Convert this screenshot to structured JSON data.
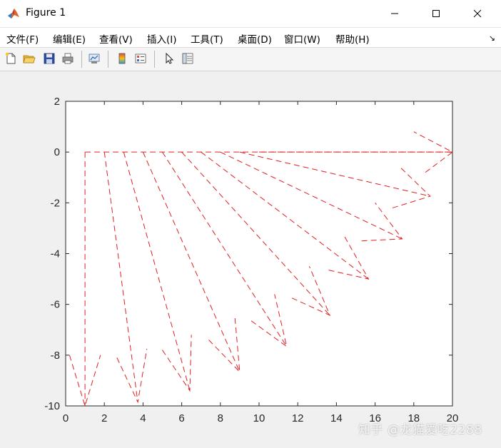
{
  "window": {
    "title": "Figure 1",
    "icon": "matlab-icon"
  },
  "menu": {
    "items": [
      {
        "label": "文件(F)",
        "name": "menu-file"
      },
      {
        "label": "编辑(E)",
        "name": "menu-edit"
      },
      {
        "label": "查看(V)",
        "name": "menu-view"
      },
      {
        "label": "插入(I)",
        "name": "menu-insert"
      },
      {
        "label": "工具(T)",
        "name": "menu-tools"
      },
      {
        "label": "桌面(D)",
        "name": "menu-desktop"
      },
      {
        "label": "窗口(W)",
        "name": "menu-window"
      },
      {
        "label": "帮助(H)",
        "name": "menu-help"
      }
    ],
    "overflow_icon": "menu-overflow-arrow-icon"
  },
  "toolbar": {
    "buttons": [
      {
        "name": "new-figure-button",
        "icon": "new-file-icon"
      },
      {
        "name": "open-file-button",
        "icon": "folder-open-icon"
      },
      {
        "name": "save-button",
        "icon": "save-disk-icon"
      },
      {
        "name": "print-button",
        "icon": "printer-icon"
      },
      {
        "name": "link-plot-button",
        "icon": "link-plot-icon"
      },
      {
        "name": "insert-colorbar-button",
        "icon": "colorbar-icon"
      },
      {
        "name": "insert-legend-button",
        "icon": "legend-icon"
      },
      {
        "name": "edit-plot-button",
        "icon": "pointer-arrow-icon"
      },
      {
        "name": "property-inspector-button",
        "icon": "property-editor-icon"
      }
    ]
  },
  "watermark": "知乎 @龙猫爱吃2288",
  "colors": {
    "line": "#e02020",
    "axes_bg": "#ffffff",
    "figure_bg": "#f0f0f0"
  },
  "chart_data": {
    "type": "line",
    "style": "dashed",
    "title": "",
    "xlabel": "",
    "ylabel": "",
    "xlim": [
      0,
      20
    ],
    "ylim": [
      -10,
      2
    ],
    "xticks": [
      0,
      2,
      4,
      6,
      8,
      10,
      12,
      14,
      16,
      18,
      20
    ],
    "yticks": [
      -10,
      -8,
      -6,
      -4,
      -2,
      0,
      2
    ],
    "grid": false,
    "legend": "none",
    "baseline": {
      "x": [
        1,
        20
      ],
      "y": [
        0,
        0
      ]
    },
    "vectors": [
      {
        "from": [
          1,
          0
        ],
        "to": [
          1,
          -10
        ],
        "head_left": [
          0.2,
          -8.0
        ],
        "head_right": [
          1.8,
          -8.0
        ]
      },
      {
        "from": [
          2,
          0
        ],
        "to": [
          3.73,
          -9.85
        ],
        "head_left": [
          2.65,
          -8.1
        ],
        "head_right": [
          4.2,
          -7.75
        ]
      },
      {
        "from": [
          3,
          0
        ],
        "to": [
          6.42,
          -9.4
        ],
        "head_left": [
          5.0,
          -7.8
        ],
        "head_right": [
          6.5,
          -7.2
        ]
      },
      {
        "from": [
          4,
          0
        ],
        "to": [
          9.0,
          -8.66
        ],
        "head_left": [
          7.4,
          -7.4
        ],
        "head_right": [
          8.75,
          -6.5
        ]
      },
      {
        "from": [
          5,
          0
        ],
        "to": [
          11.43,
          -7.66
        ],
        "head_left": [
          9.6,
          -6.65
        ],
        "head_right": [
          10.8,
          -5.6
        ]
      },
      {
        "from": [
          6,
          0
        ],
        "to": [
          13.66,
          -6.43
        ],
        "head_left": [
          11.7,
          -5.75
        ],
        "head_right": [
          12.6,
          -4.5
        ]
      },
      {
        "from": [
          7,
          0
        ],
        "to": [
          15.66,
          -5.0
        ],
        "head_left": [
          13.6,
          -4.65
        ],
        "head_right": [
          14.4,
          -3.3
        ]
      },
      {
        "from": [
          8,
          0
        ],
        "to": [
          17.4,
          -3.42
        ],
        "head_left": [
          15.3,
          -3.5
        ],
        "head_right": [
          16.0,
          -2.0
        ]
      },
      {
        "from": [
          9,
          0
        ],
        "to": [
          18.85,
          -1.74
        ],
        "head_left": [
          16.9,
          -2.2
        ],
        "head_right": [
          17.3,
          -0.6
        ]
      },
      {
        "from": [
          10,
          0
        ],
        "to": [
          20.0,
          0.0
        ],
        "head_left": [
          18.6,
          -0.8
        ],
        "head_right": [
          18.0,
          0.8
        ]
      }
    ]
  }
}
